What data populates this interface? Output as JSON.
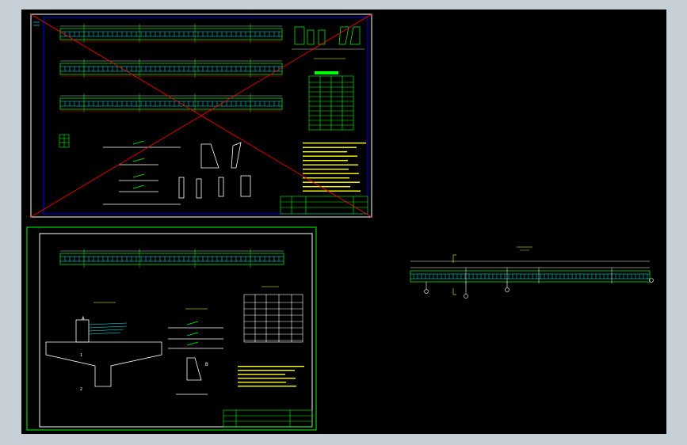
{
  "colors": {
    "background": "#c6ced6",
    "modelspace": "#000000",
    "sheet_border_top": "#ffffff",
    "sheet_border_bottom": "#00ff00",
    "inner_frame": "#0000ff",
    "cross_out": "#ff0000",
    "rebar": "#00ffff",
    "linework": "#00ff00",
    "dimension": "#ffffff",
    "annotation": "#ffff00"
  },
  "drawing_labels": {
    "detail_a": "A",
    "detail_b": "B",
    "section_1": "1",
    "section_2": "2"
  }
}
